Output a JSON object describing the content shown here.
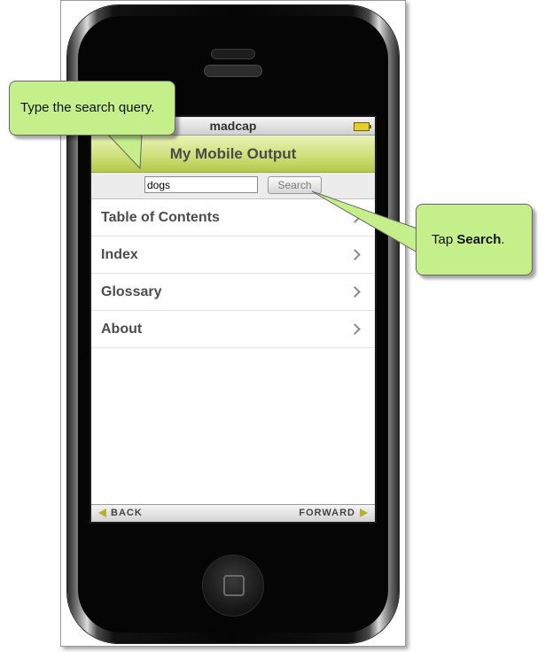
{
  "device": {
    "carrier_title": "madcap"
  },
  "app": {
    "title": "My Mobile Output"
  },
  "search": {
    "value": "dogs",
    "button_label": "Search"
  },
  "menu": {
    "items": [
      {
        "label": "Table of Contents"
      },
      {
        "label": "Index"
      },
      {
        "label": "Glossary"
      },
      {
        "label": "About"
      }
    ]
  },
  "nav": {
    "back_label": "BACK",
    "forward_label": "FORWARD"
  },
  "callouts": {
    "search_query": "Type the search query.",
    "tap_prefix": "Tap ",
    "tap_bold": "Search",
    "tap_suffix": "."
  },
  "colors": {
    "callout_fill": "#c5ef8a",
    "title_bar_accent": "#cfe07a",
    "nav_arrow": "#b9b02a"
  }
}
